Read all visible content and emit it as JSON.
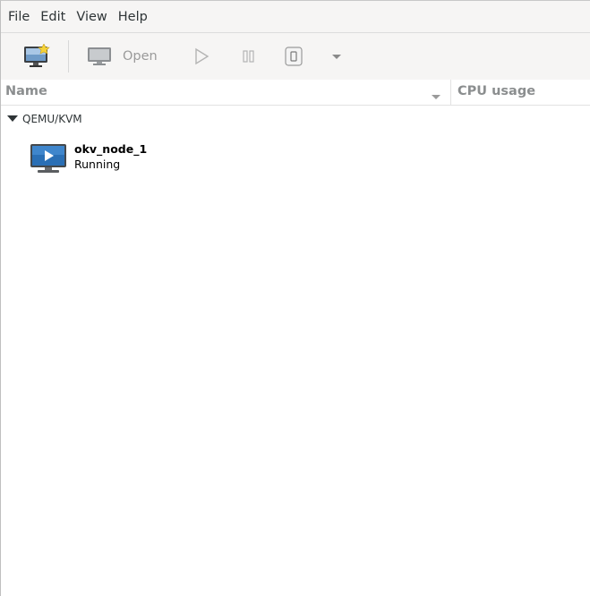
{
  "menubar": {
    "items": [
      "File",
      "Edit",
      "View",
      "Help"
    ]
  },
  "toolbar": {
    "new_vm_icon": "new-vm-icon",
    "open_label": "Open",
    "open_icon": "monitor-icon",
    "run_icon": "play-icon",
    "pause_icon": "pause-icon",
    "shutdown_icon": "power-icon",
    "shutdown_menu_icon": "chevron-down-icon"
  },
  "columns": {
    "name": "Name",
    "cpu": "CPU usage"
  },
  "tree": {
    "group_label": "QEMU/KVM",
    "vms": [
      {
        "name": "okv_node_1",
        "status": "Running",
        "icon": "vm-running-icon"
      }
    ]
  },
  "colors": {
    "toolbar_bg": "#f6f5f4",
    "disabled_text": "#9a9a9a",
    "header_text": "#8b8e8f",
    "monitor_blue": "#2a6fb5"
  }
}
